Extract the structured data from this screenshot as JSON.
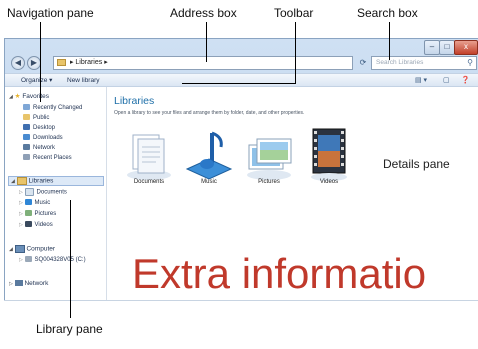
{
  "callouts": {
    "navigation_pane": "Navigation pane",
    "address_box": "Address box",
    "toolbar": "Toolbar",
    "search_box": "Search box",
    "details_pane": "Details pane",
    "library_pane": "Library pane"
  },
  "window": {
    "controls": {
      "minimize": "–",
      "maximize": "□",
      "close": "x"
    },
    "address": "▸ Libraries ▸",
    "search_placeholder": "Search Libraries",
    "toolbar": {
      "organize": "Organize ▾",
      "new_library": "New library"
    }
  },
  "nav": {
    "favorites_header": "Favorites",
    "favorites": [
      "Recently Changed",
      "Public",
      "Desktop",
      "Downloads",
      "Network",
      "Recent Places"
    ],
    "libraries_header": "Libraries",
    "libraries": [
      "Documents",
      "Music",
      "Pictures",
      "Videos"
    ],
    "computer_header": "Computer",
    "computer_items": [
      "SQ004328V05 (C:)"
    ],
    "network_header": "Network"
  },
  "content": {
    "title": "Libraries",
    "description": "Open a library to see your files and arrange them by folder, date, and other properties.",
    "libraries": [
      "Documents",
      "Music",
      "Pictures",
      "Videos"
    ]
  },
  "overlay_text": "Extra informatio",
  "colors": {
    "accent": "#1e6fa8",
    "overlay": "#c0392b",
    "chrome": "#cfe0f3"
  }
}
